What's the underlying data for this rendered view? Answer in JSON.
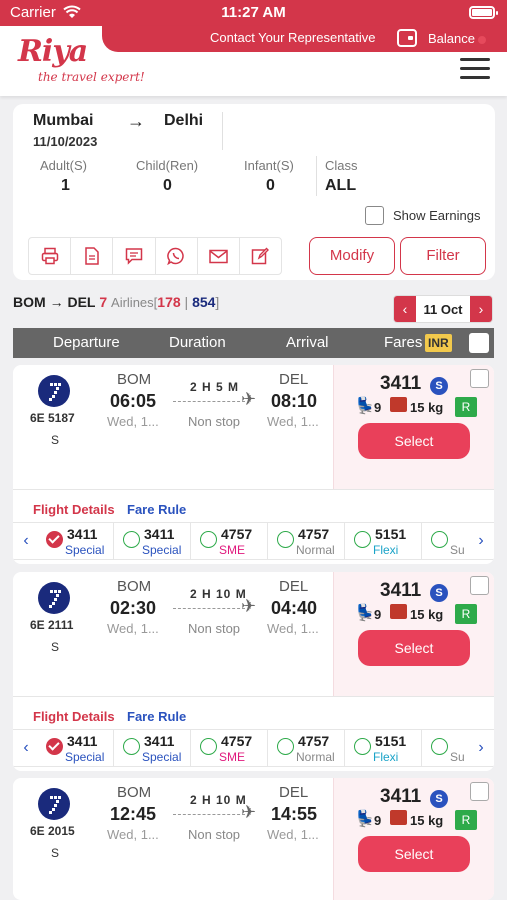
{
  "status_bar": {
    "carrier": "Carrier",
    "time": "11:27 AM"
  },
  "header": {
    "contact": "Contact Your Representative",
    "balance": "Balance",
    "logo_text": "Riya",
    "logo_tagline": "the travel expert!"
  },
  "search": {
    "from": "Mumbai",
    "to": "Delhi",
    "date": "11/10/2023",
    "adult_label": "Adult(S)",
    "adult": "1",
    "child_label": "Child(Ren)",
    "child": "0",
    "infant_label": "Infant(S)",
    "infant": "0",
    "class_label": "Class",
    "class": "ALL",
    "show_earnings": "Show Earnings",
    "modify": "Modify",
    "filter": "Filter"
  },
  "summary": {
    "from": "BOM",
    "to": "DEL",
    "airline_count": "7",
    "airlines_label": "Airlines[",
    "flights": "178",
    "sep": "|",
    "total": "854",
    "close": "]",
    "date": "11 Oct"
  },
  "table_header": {
    "departure": "Departure",
    "duration": "Duration",
    "arrival": "Arrival",
    "fares": "Fares",
    "currency": "INR"
  },
  "links": {
    "flight_details": "Flight Details",
    "fare_rule": "Fare Rule"
  },
  "select_label": "Select",
  "flights": [
    {
      "number": "6E 5187",
      "cls": "S",
      "dep_code": "BOM",
      "dep_time": "06:05",
      "dep_day": "Wed, 1...",
      "duration": "2 H 5 M",
      "stops": "Non stop",
      "arr_code": "DEL",
      "arr_time": "08:10",
      "arr_day": "Wed, 1...",
      "price": "3411",
      "fare_badge": "S",
      "seats": "9",
      "baggage": "15 kg",
      "refund": "R"
    },
    {
      "number": "6E 2111",
      "cls": "S",
      "dep_code": "BOM",
      "dep_time": "02:30",
      "dep_day": "Wed, 1...",
      "duration": "2 H 10 M",
      "stops": "Non stop",
      "arr_code": "DEL",
      "arr_time": "04:40",
      "arr_day": "Wed, 1...",
      "price": "3411",
      "fare_badge": "S",
      "seats": "9",
      "baggage": "15 kg",
      "refund": "R"
    },
    {
      "number": "6E 2015",
      "cls": "S",
      "dep_code": "BOM",
      "dep_time": "12:45",
      "dep_day": "Wed, 1...",
      "duration": "2 H 10 M",
      "stops": "Non stop",
      "arr_code": "DEL",
      "arr_time": "14:55",
      "arr_day": "Wed, 1...",
      "price": "3411",
      "fare_badge": "S",
      "seats": "9",
      "baggage": "15 kg",
      "refund": "R"
    }
  ],
  "fare_options": [
    {
      "price": "3411",
      "label": "Special",
      "color": "#2a52be",
      "selected": true
    },
    {
      "price": "3411",
      "label": "Special",
      "color": "#2a52be",
      "selected": false
    },
    {
      "price": "4757",
      "label": "SME",
      "color": "#e0197d",
      "selected": false
    },
    {
      "price": "4757",
      "label": "Normal",
      "color": "#888888",
      "selected": false
    },
    {
      "price": "5151",
      "label": "Flexi",
      "color": "#1aa3c8",
      "selected": false
    },
    {
      "price": "",
      "label": "Su",
      "color": "#888888",
      "selected": false
    }
  ],
  "colors": {
    "brand": "#d3364a",
    "select": "#e9405a",
    "badge_blue": "#2a52be",
    "refund_green": "#2eaa4a",
    "header_gray": "#666666"
  }
}
